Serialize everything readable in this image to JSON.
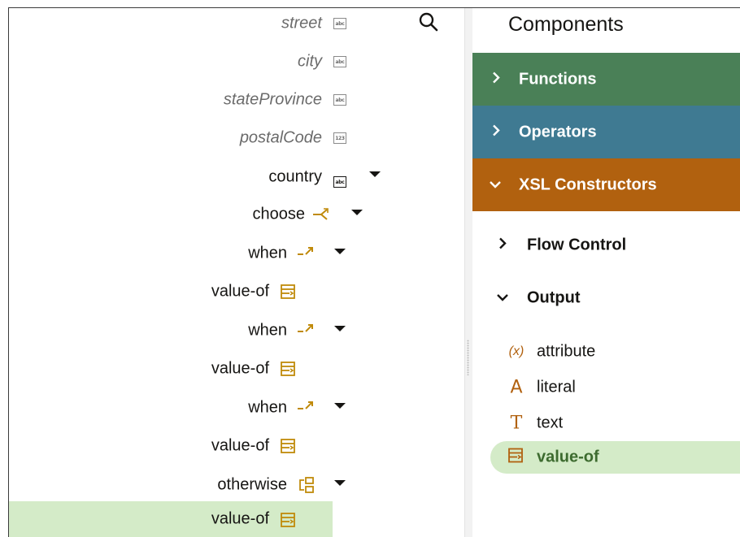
{
  "tree": {
    "nodes": [
      {
        "label": "street",
        "icon": "string-type-icon"
      },
      {
        "label": "city",
        "icon": "string-type-icon"
      },
      {
        "label": "stateProvince",
        "icon": "string-type-icon"
      },
      {
        "label": "postalCode",
        "icon": "number-type-icon"
      },
      {
        "label": "country",
        "icon": "string-type-icon"
      },
      {
        "label": "choose",
        "icon": "choose-icon"
      },
      {
        "label": "when",
        "icon": "when-icon"
      },
      {
        "label": "value-of",
        "icon": "value-of-icon"
      },
      {
        "label": "when",
        "icon": "when-icon"
      },
      {
        "label": "value-of",
        "icon": "value-of-icon"
      },
      {
        "label": "when",
        "icon": "when-icon"
      },
      {
        "label": "value-of",
        "icon": "value-of-icon"
      },
      {
        "label": "otherwise",
        "icon": "otherwise-icon"
      },
      {
        "label": "value-of",
        "icon": "value-of-icon"
      }
    ]
  },
  "components": {
    "title": "Components",
    "sections": [
      {
        "label": "Functions",
        "color": "#4a8057",
        "expanded": false
      },
      {
        "label": "Operators",
        "color": "#3f7a92",
        "expanded": false
      },
      {
        "label": "XSL Constructors",
        "color": "#b1610f",
        "expanded": true
      }
    ],
    "groups": [
      {
        "label": "Flow Control",
        "expanded": false
      },
      {
        "label": "Output",
        "expanded": true
      }
    ],
    "output_items": [
      {
        "label": "attribute",
        "icon": "variable-icon",
        "glyph": "(x)"
      },
      {
        "label": "literal",
        "icon": "literal-icon",
        "glyph": "A"
      },
      {
        "label": "text",
        "icon": "text-icon",
        "glyph": "T"
      },
      {
        "label": "value-of",
        "icon": "value-of-icon",
        "glyph": ""
      }
    ]
  },
  "colors": {
    "accent_orange": "#b1610f",
    "selection_green": "#d4ebc8"
  }
}
